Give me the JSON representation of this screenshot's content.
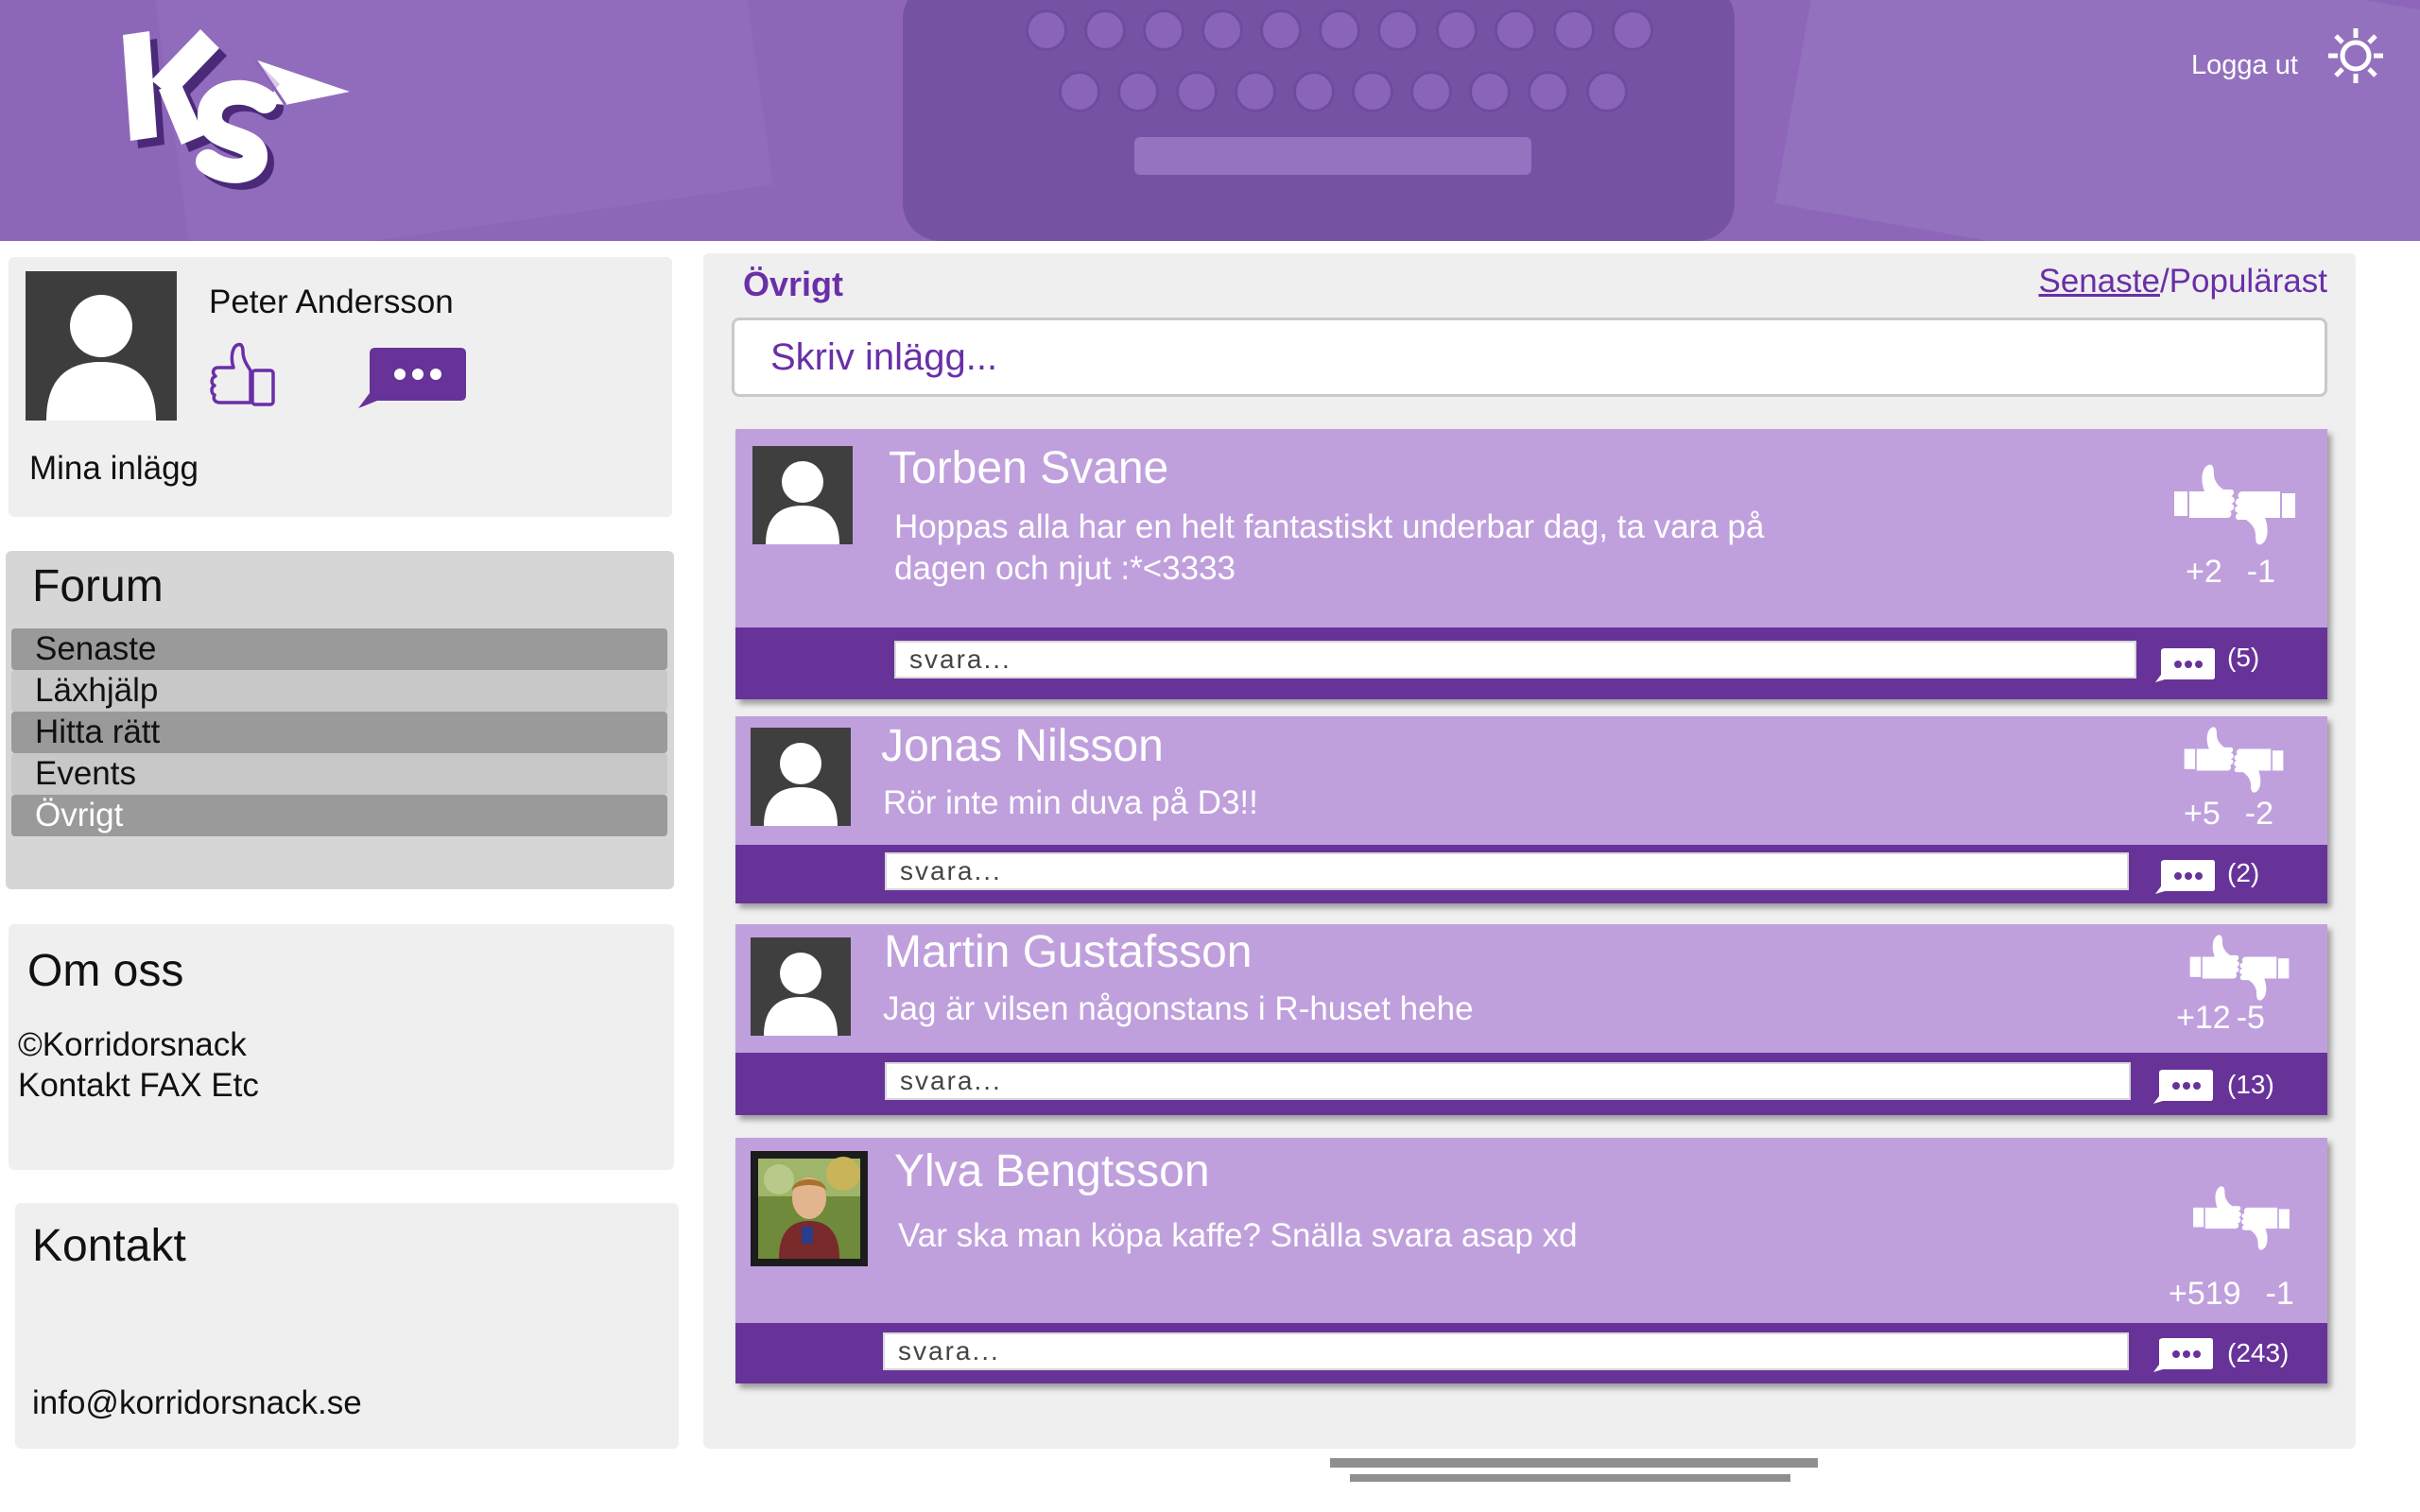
{
  "header": {
    "logout_label": "Logga ut",
    "logo_icon": "ks-paper-plane-logo",
    "settings_icon": "gear-icon",
    "background_color": "#8d66b9"
  },
  "profile": {
    "name": "Peter Andersson",
    "my_posts_label": "Mina inlägg",
    "icons": [
      "avatar",
      "thumbs-up-icon",
      "chat-bubble-icon"
    ]
  },
  "forum": {
    "title": "Forum",
    "items": [
      {
        "label": "Senaste"
      },
      {
        "label": "Läxhjälp"
      },
      {
        "label": "Hitta rätt"
      },
      {
        "label": "Events"
      },
      {
        "label": "Övrigt",
        "active": true
      }
    ]
  },
  "about": {
    "title": "Om oss",
    "copyright": "©Korridorsnack",
    "contact_line": "Kontakt FAX Etc"
  },
  "contact": {
    "title": "Kontakt",
    "email": "info@korridorsnack.se"
  },
  "main": {
    "section_title": "Övrigt",
    "sort_latest": "Senaste",
    "sort_separator": "/",
    "sort_popular": "Populärast",
    "new_post_placeholder": "Skriv inlägg...",
    "accent_color": "#673399",
    "post_color": "#bfa0dd"
  },
  "posts": [
    {
      "author": "Torben Svane",
      "text_line1": "Hoppas alla har en helt fantastiskt underbar dag, ta vara på",
      "text_line2": "dagen och njut :*<3333",
      "up": "+2",
      "down": "-1",
      "reply_placeholder": "svara...",
      "comments": "(5)"
    },
    {
      "author": "Jonas Nilsson",
      "text_line1": "Rör inte min duva på D3!!",
      "up": "+5",
      "down": "-2",
      "reply_placeholder": "svara...",
      "comments": "(2)"
    },
    {
      "author": "Martin Gustafsson",
      "text_line1": "Jag är vilsen någonstans i R-huset hehe",
      "up": "+12",
      "down": "-5",
      "reply_placeholder": "svara...",
      "comments": "(13)"
    },
    {
      "author": "Ylva Bengtsson",
      "text_line1": "Var ska man köpa kaffe? Snälla svara asap xd",
      "up": "+519",
      "down": "-1",
      "reply_placeholder": "svara...",
      "comments": "(243)"
    }
  ]
}
